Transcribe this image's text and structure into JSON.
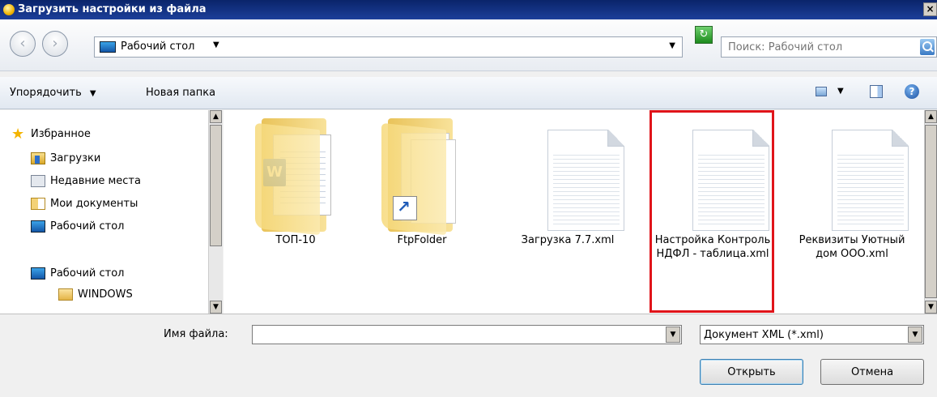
{
  "window": {
    "title": "Загрузить настройки из файла",
    "close_glyph": "×"
  },
  "nav": {
    "back_glyph": "‹",
    "forward_glyph": "›",
    "address": "Рабочий стол",
    "address_chevron": "▼",
    "address_dropdown": "▼",
    "refresh_glyph": "↻",
    "search_placeholder": "Поиск: Рабочий стол"
  },
  "toolbar": {
    "organize_label": "Упорядочить",
    "organize_arrow": "▼",
    "new_folder_label": "Новая папка",
    "views_arrow": "▼",
    "help_glyph": "?"
  },
  "sidebar": {
    "favorites": "Избранное",
    "items": [
      "Загрузки",
      "Недавние места",
      "Мои документы",
      "Рабочий стол"
    ],
    "desktop": "Рабочий стол",
    "windows": "WINDOWS"
  },
  "files": [
    {
      "name": "ТОП-10",
      "kind": "folder-word"
    },
    {
      "name": "FtpFolder",
      "kind": "folder-shortcut"
    },
    {
      "name": "Загрузка 7.7.xml",
      "kind": "xml"
    },
    {
      "name": "Настройка Контроль НДФЛ - таблица.xml",
      "kind": "xml",
      "highlighted": true
    },
    {
      "name": "Реквизиты Уютный дом ООО.xml",
      "kind": "xml"
    }
  ],
  "scroll": {
    "up": "▲",
    "down": "▼"
  },
  "bottom": {
    "filename_label": "Имя файла:",
    "filename_value": "",
    "filetype_value": "Документ XML (*.xml)",
    "dropdown_glyph": "▼",
    "open_label": "Открыть",
    "cancel_label": "Отмена"
  },
  "colors": {
    "title_bar": "#0a246a",
    "highlight": "#e0141a"
  }
}
